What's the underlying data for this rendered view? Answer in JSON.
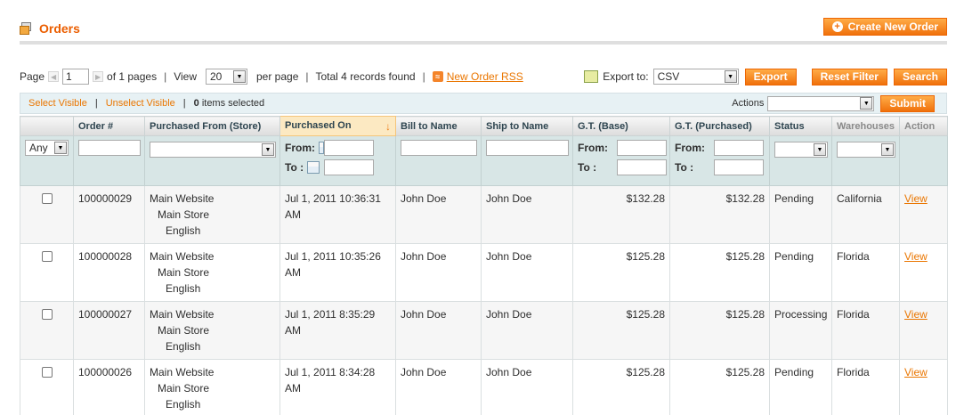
{
  "header": {
    "title": "Orders",
    "create_label": "Create New Order"
  },
  "pager": {
    "page_label": "Page",
    "page_value": "1",
    "of_pages": "of 1 pages",
    "view_label": "View",
    "view_value": "20",
    "per_page": "per page",
    "total": "Total 4 records found",
    "rss": "New Order RSS",
    "export_label": "Export to:",
    "export_value": "CSV",
    "export_btn": "Export",
    "reset_btn": "Reset Filter",
    "search_btn": "Search"
  },
  "massaction": {
    "select_visible": "Select Visible",
    "unselect_visible": "Unselect Visible",
    "count": "0",
    "selected_text": "items selected",
    "actions_label": "Actions",
    "submit": "Submit"
  },
  "columns": [
    "Order #",
    "Purchased From (Store)",
    "Purchased On",
    "Bill to Name",
    "Ship to Name",
    "G.T. (Base)",
    "G.T. (Purchased)",
    "Status",
    "Warehouses",
    "Action"
  ],
  "filters": {
    "any": "Any",
    "from": "From:",
    "to": "To :"
  },
  "colors": {
    "accent": "#eb5e00",
    "button": "#f0710c",
    "header_bg": "#e7f1f4"
  },
  "rows": [
    {
      "order": "100000029",
      "store1": "Main Website",
      "store2": "Main Store",
      "store3": "English",
      "date1": "Jul 1, 2011 10:36:31",
      "date2": "AM",
      "bill": "John Doe",
      "ship": "John Doe",
      "base": "$132.28",
      "purchased": "$132.28",
      "status": "Pending",
      "warehouse": "California",
      "action": "View"
    },
    {
      "order": "100000028",
      "store1": "Main Website",
      "store2": "Main Store",
      "store3": "English",
      "date1": "Jul 1, 2011 10:35:26",
      "date2": "AM",
      "bill": "John Doe",
      "ship": "John Doe",
      "base": "$125.28",
      "purchased": "$125.28",
      "status": "Pending",
      "warehouse": "Florida",
      "action": "View"
    },
    {
      "order": "100000027",
      "store1": "Main Website",
      "store2": "Main Store",
      "store3": "English",
      "date1": "Jul 1, 2011 8:35:29",
      "date2": "AM",
      "bill": "John Doe",
      "ship": "John Doe",
      "base": "$125.28",
      "purchased": "$125.28",
      "status": "Processing",
      "warehouse": "Florida",
      "action": "View"
    },
    {
      "order": "100000026",
      "store1": "Main Website",
      "store2": "Main Store",
      "store3": "English",
      "date1": "Jul 1, 2011 8:34:28",
      "date2": "AM",
      "bill": "John Doe",
      "ship": "John Doe",
      "base": "$125.28",
      "purchased": "$125.28",
      "status": "Pending",
      "warehouse": "Florida",
      "action": "View"
    }
  ]
}
